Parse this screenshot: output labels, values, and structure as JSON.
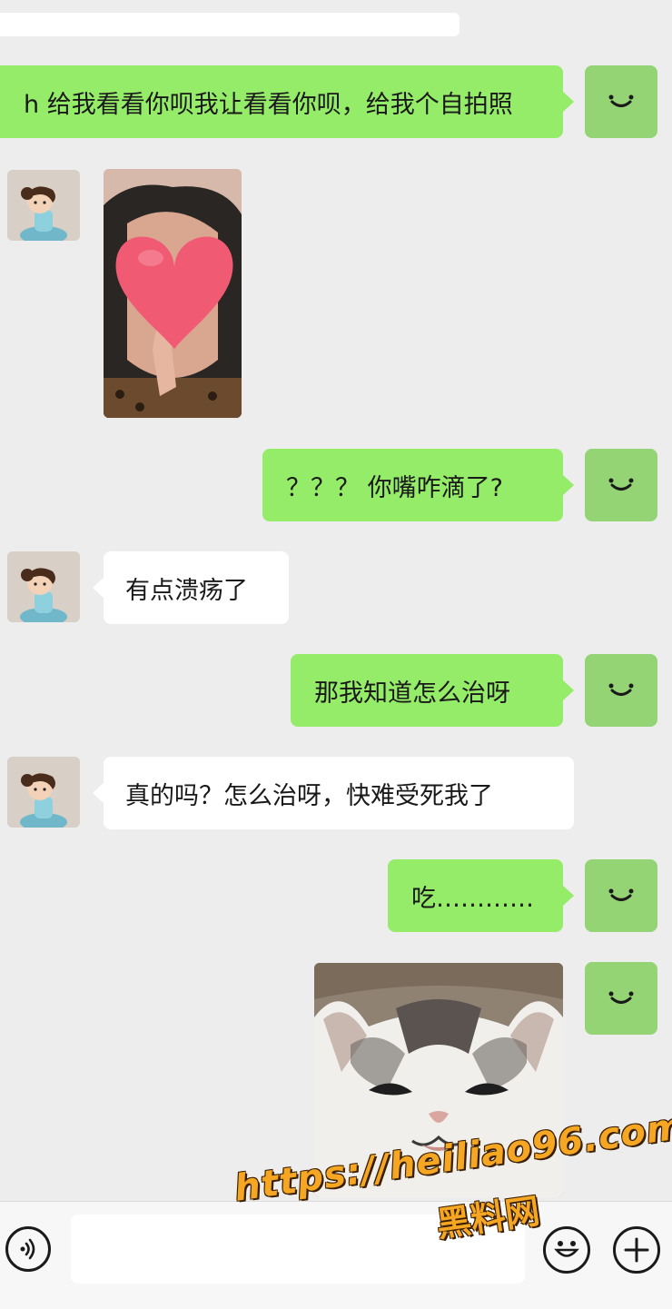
{
  "messages": {
    "m1": "h 给我看看你呗我让看看你呗，给我个自拍照",
    "m3": "？？？ 你嘴咋滴了?",
    "m4": "有点溃疡了",
    "m5": "那我知道怎么治呀",
    "m6": "真的吗？怎么治呀，快难受死我了",
    "m7": "吃…………"
  },
  "photos": {
    "selfie": "heart-covered-selfie",
    "cat": "smirking-cat-sticker"
  },
  "watermark": {
    "url": "https://heiliao96.com",
    "name": "黑料网"
  },
  "colors": {
    "my_bubble": "#95ec69",
    "her_bubble": "#ffffff",
    "background": "#ededed",
    "my_avatar": "#95d475",
    "watermark": "#f5a623"
  }
}
